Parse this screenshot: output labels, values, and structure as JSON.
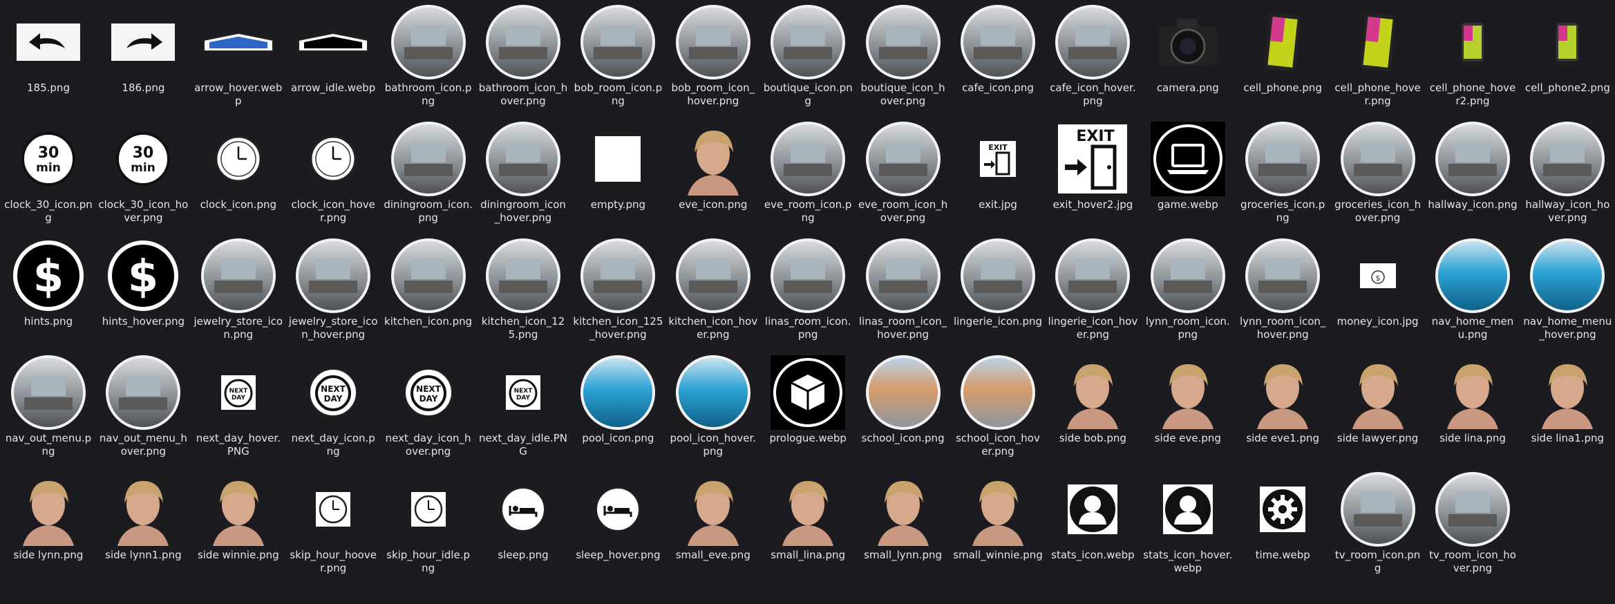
{
  "files": [
    {
      "name": "185.png",
      "icon": "left-arrow-icon"
    },
    {
      "name": "186.png",
      "icon": "right-arrow-icon"
    },
    {
      "name": "arrow_hover.webp",
      "icon": "arrow-hover-icon"
    },
    {
      "name": "arrow_idle.webp",
      "icon": "arrow-idle-icon"
    },
    {
      "name": "bathroom_icon.png",
      "icon": "room-icon"
    },
    {
      "name": "bathroom_icon_hover.png",
      "icon": "room-icon"
    },
    {
      "name": "bob_room_icon.png",
      "icon": "room-icon"
    },
    {
      "name": "bob_room_icon_hover.png",
      "icon": "room-icon"
    },
    {
      "name": "boutique_icon.png",
      "icon": "room-icon"
    },
    {
      "name": "boutique_icon_hover.png",
      "icon": "room-icon"
    },
    {
      "name": "cafe_icon.png",
      "icon": "room-icon"
    },
    {
      "name": "cafe_icon_hover.png",
      "icon": "room-icon"
    },
    {
      "name": "camera.png",
      "icon": "camera-icon"
    },
    {
      "name": "cell_phone.png",
      "icon": "phone-icon"
    },
    {
      "name": "cell_phone_hover.png",
      "icon": "phone-icon"
    },
    {
      "name": "cell_phone_hover2.png",
      "icon": "phone-small-icon"
    },
    {
      "name": "cell_phone2.png",
      "icon": "phone-small-icon"
    },
    {
      "name": "clock_30_icon.png",
      "icon": "clock-30-icon"
    },
    {
      "name": "clock_30_icon_hover.png",
      "icon": "clock-30-icon"
    },
    {
      "name": "clock_icon.png",
      "icon": "clock-icon"
    },
    {
      "name": "clock_icon_hover.png",
      "icon": "clock-icon"
    },
    {
      "name": "diningroom_icon.png",
      "icon": "room-icon"
    },
    {
      "name": "diningroom_icon_hover.png",
      "icon": "room-icon"
    },
    {
      "name": "empty.png",
      "icon": "blank-square-icon"
    },
    {
      "name": "eve_icon.png",
      "icon": "portrait-icon"
    },
    {
      "name": "eve_room_icon.png",
      "icon": "room-icon"
    },
    {
      "name": "eve_room_icon_hover.png",
      "icon": "room-icon"
    },
    {
      "name": "exit.jpg",
      "icon": "exit-small-icon"
    },
    {
      "name": "exit_hover2.jpg",
      "icon": "exit-icon"
    },
    {
      "name": "game.webp",
      "icon": "laptop-icon"
    },
    {
      "name": "groceries_icon.png",
      "icon": "room-icon"
    },
    {
      "name": "groceries_icon_hover.png",
      "icon": "room-icon"
    },
    {
      "name": "hallway_icon.png",
      "icon": "room-icon"
    },
    {
      "name": "hallway_icon_hover.png",
      "icon": "room-icon"
    },
    {
      "name": "hints.png",
      "icon": "dollar-icon"
    },
    {
      "name": "hints_hover.png",
      "icon": "dollar-icon"
    },
    {
      "name": "jewelry_store_icon.png",
      "icon": "room-icon"
    },
    {
      "name": "jewelry_store_icon_hover.png",
      "icon": "room-icon"
    },
    {
      "name": "kitchen_icon.png",
      "icon": "room-icon"
    },
    {
      "name": "kitchen_icon_125.png",
      "icon": "room-icon"
    },
    {
      "name": "kitchen_icon_125_hover.png",
      "icon": "room-icon"
    },
    {
      "name": "kitchen_icon_hover.png",
      "icon": "room-icon"
    },
    {
      "name": "linas_room_icon.png",
      "icon": "room-icon"
    },
    {
      "name": "linas_room_icon_hover.png",
      "icon": "room-icon"
    },
    {
      "name": "lingerie_icon.png",
      "icon": "room-icon"
    },
    {
      "name": "lingerie_icon_hover.png",
      "icon": "room-icon"
    },
    {
      "name": "lynn_room_icon.png",
      "icon": "room-icon"
    },
    {
      "name": "lynn_room_icon_hover.png",
      "icon": "room-icon"
    },
    {
      "name": "money_icon.jpg",
      "icon": "money-icon"
    },
    {
      "name": "nav_home_menu.png",
      "icon": "pool-icon"
    },
    {
      "name": "nav_home_menu_hover.png",
      "icon": "pool-icon"
    },
    {
      "name": "nav_out_menu.png",
      "icon": "room-icon"
    },
    {
      "name": "nav_out_menu_hover.png",
      "icon": "room-icon"
    },
    {
      "name": "next_day_hover.PNG",
      "icon": "next-day-small-icon"
    },
    {
      "name": "next_day_icon.png",
      "icon": "next-day-icon"
    },
    {
      "name": "next_day_icon_hover.png",
      "icon": "next-day-icon"
    },
    {
      "name": "next_day_idle.PNG",
      "icon": "next-day-small-icon"
    },
    {
      "name": "pool_icon.png",
      "icon": "pool-icon"
    },
    {
      "name": "pool_icon_hover.png",
      "icon": "pool-icon"
    },
    {
      "name": "prologue.webp",
      "icon": "box-icon"
    },
    {
      "name": "school_icon.png",
      "icon": "school-icon"
    },
    {
      "name": "school_icon_hover.png",
      "icon": "school-icon"
    },
    {
      "name": "side bob.png",
      "icon": "portrait-icon"
    },
    {
      "name": "side eve.png",
      "icon": "portrait-icon"
    },
    {
      "name": "side eve1.png",
      "icon": "portrait-icon"
    },
    {
      "name": "side lawyer.png",
      "icon": "portrait-icon"
    },
    {
      "name": "side lina.png",
      "icon": "portrait-icon"
    },
    {
      "name": "side lina1.png",
      "icon": "portrait-icon"
    },
    {
      "name": "side lynn.png",
      "icon": "portrait-icon"
    },
    {
      "name": "side lynn1.png",
      "icon": "portrait-icon"
    },
    {
      "name": "side winnie.png",
      "icon": "portrait-icon"
    },
    {
      "name": "skip_hour_hoover.png",
      "icon": "clock-small-icon"
    },
    {
      "name": "skip_hour_idle.png",
      "icon": "clock-small-icon"
    },
    {
      "name": "sleep.png",
      "icon": "sleep-icon"
    },
    {
      "name": "sleep_hover.png",
      "icon": "sleep-icon"
    },
    {
      "name": "small_eve.png",
      "icon": "portrait-icon"
    },
    {
      "name": "small_lina.png",
      "icon": "portrait-icon"
    },
    {
      "name": "small_lynn.png",
      "icon": "portrait-icon"
    },
    {
      "name": "small_winnie.png",
      "icon": "portrait-icon"
    },
    {
      "name": "stats_icon.webp",
      "icon": "user-icon"
    },
    {
      "name": "stats_icon_hover.webp",
      "icon": "user-icon"
    },
    {
      "name": "time.webp",
      "icon": "gear-icon"
    },
    {
      "name": "tv_room_icon.png",
      "icon": "room-icon"
    },
    {
      "name": "tv_room_icon_hover.png",
      "icon": "room-icon"
    }
  ]
}
